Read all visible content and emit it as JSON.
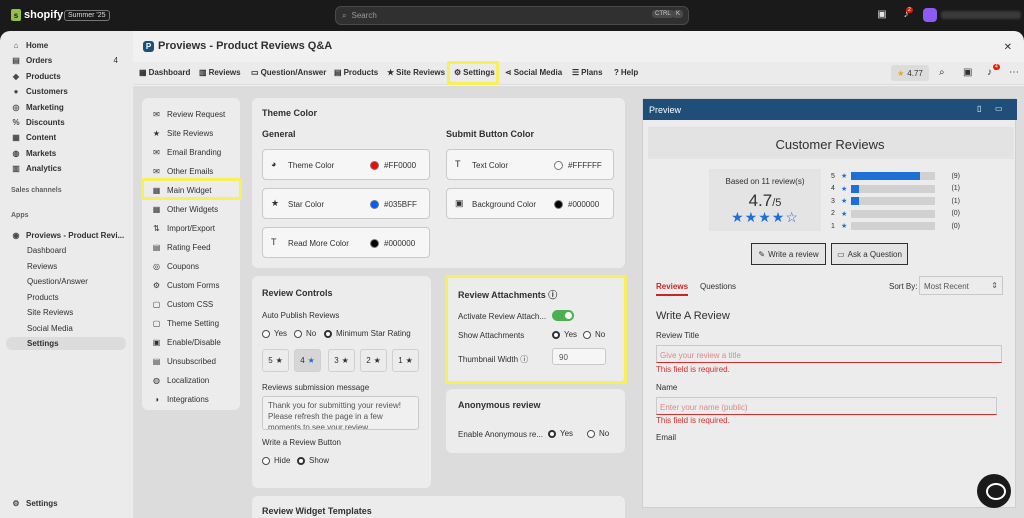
{
  "topbar": {
    "brand": "shopify",
    "badge": "Summer '25",
    "search_placeholder": "Search",
    "kbd1": "CTRL",
    "kbd2": "K",
    "bell_count": "2"
  },
  "sidebar": {
    "items": [
      {
        "label": "Home",
        "icon": "home-icon"
      },
      {
        "label": "Orders",
        "icon": "orders-icon",
        "count": "4"
      },
      {
        "label": "Products",
        "icon": "tag-icon"
      },
      {
        "label": "Customers",
        "icon": "person-icon"
      },
      {
        "label": "Marketing",
        "icon": "target-icon"
      },
      {
        "label": "Discounts",
        "icon": "discount-icon"
      },
      {
        "label": "Content",
        "icon": "content-icon"
      },
      {
        "label": "Markets",
        "icon": "globe-icon"
      },
      {
        "label": "Analytics",
        "icon": "chart-icon"
      }
    ],
    "sales_channels": "Sales channels",
    "apps": "Apps",
    "app_name": "Proviews - Product Revi...",
    "app_sub": [
      "Dashboard",
      "Reviews",
      "Question/Answer",
      "Products",
      "Site Reviews",
      "Social Media",
      "Settings"
    ],
    "settings": "Settings"
  },
  "app": {
    "title": "Proviews - Product Reviews Q&A",
    "tabs": [
      "Dashboard",
      "Reviews",
      "Question/Answer",
      "Products",
      "Site Reviews",
      "Settings",
      "Social Media",
      "Plans",
      "Help"
    ],
    "rating": "4.77",
    "alert_count": "4"
  },
  "settings_menu": [
    "Review Request",
    "Site Reviews",
    "Email Branding",
    "Other Emails",
    "Main Widget",
    "Other Widgets",
    "Import/Export",
    "Rating Feed",
    "Coupons",
    "Custom Forms",
    "Custom CSS",
    "Theme Setting",
    "Enable/Disable",
    "Unsubscribed",
    "Localization",
    "Integrations"
  ],
  "theme": {
    "title": "Theme Color",
    "general": "General",
    "submit": "Submit Button Color",
    "items": [
      {
        "label": "Theme Color",
        "hex": "#FF0000",
        "color": "#FF0000"
      },
      {
        "label": "Star Color",
        "hex": "#035BFF",
        "color": "#035BFF"
      },
      {
        "label": "Read More Color",
        "hex": "#000000",
        "color": "#000000"
      }
    ],
    "submit_items": [
      {
        "label": "Text Color",
        "hex": "#FFFFFF",
        "color": "#FFFFFF"
      },
      {
        "label": "Background Color",
        "hex": "#000000",
        "color": "#000000"
      }
    ]
  },
  "review_controls": {
    "title": "Review Controls",
    "auto_publish": "Auto Publish Reviews",
    "opts": [
      "Yes",
      "No",
      "Minimum Star Rating"
    ],
    "stars": [
      "5",
      "4",
      "3",
      "2",
      "1"
    ],
    "msg_label": "Reviews submission message",
    "msg": "Thank you for submitting your review! Please refresh the page in a few moments to see your review.",
    "write_btn_label": "Write a Review Button",
    "write_opts": [
      "Hide",
      "Show"
    ]
  },
  "attachments": {
    "title": "Review Attachments",
    "activate": "Activate Review Attach...",
    "show": "Show Attachments",
    "yes": "Yes",
    "no": "No",
    "thumb": "Thumbnail Width",
    "thumb_value": "90"
  },
  "anonymous": {
    "title": "Anonymous review",
    "enable": "Enable Anonymous re...",
    "yes": "Yes",
    "no": "No"
  },
  "templates": {
    "title": "Review Widget Templates"
  },
  "preview": {
    "title": "Preview",
    "heading": "Customer Reviews",
    "based": "Based on 11 review(s)",
    "avg": "4.7",
    "outof": "/5",
    "bars": [
      {
        "star": "5",
        "count": "(9)",
        "frac": 0.82
      },
      {
        "star": "4",
        "count": "(1)",
        "frac": 0.09
      },
      {
        "star": "3",
        "count": "(1)",
        "frac": 0.09
      },
      {
        "star": "2",
        "count": "(0)",
        "frac": 0
      },
      {
        "star": "1",
        "count": "(0)",
        "frac": 0
      }
    ],
    "write_btn": "Write a review",
    "ask_btn": "Ask a Question",
    "tab_reviews": "Reviews",
    "tab_questions": "Questions",
    "sort_label": "Sort By:",
    "sort_value": "Most Recent",
    "form_title": "Write A Review",
    "f_title": "Review Title",
    "f_title_ph": "Give your review a title",
    "required": "This field is required.",
    "f_name": "Name",
    "f_name_ph": "Enter your name (public)",
    "f_email": "Email"
  }
}
